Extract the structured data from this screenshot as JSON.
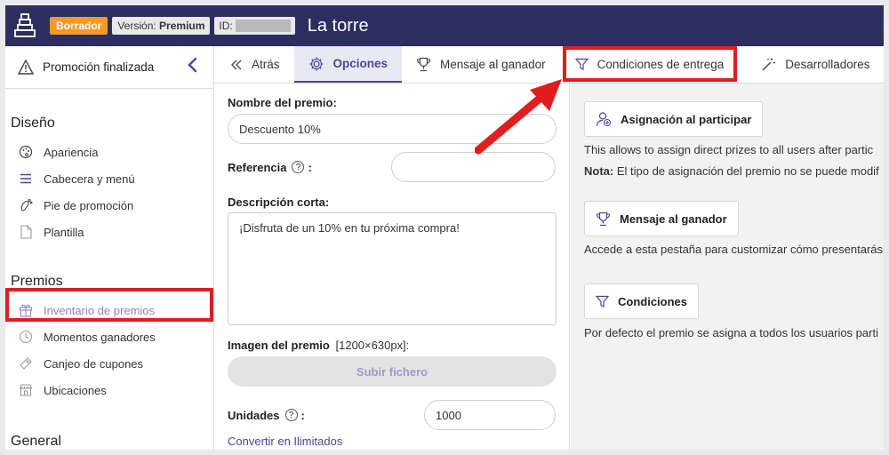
{
  "header": {
    "status_badge": "Borrador",
    "version_prefix": "Versión: ",
    "version_value": "Premium",
    "id_label": "ID:",
    "title": "La torre"
  },
  "sidebar": {
    "promo_status": "Promoción finalizada",
    "sections": [
      {
        "title": "Diseño",
        "items": [
          {
            "label": "Apariencia",
            "icon": "palette-icon"
          },
          {
            "label": "Cabecera y menú",
            "icon": "menu-icon"
          },
          {
            "label": "Pie de promoción",
            "icon": "footprint-icon"
          },
          {
            "label": "Plantilla",
            "icon": "document-icon"
          }
        ]
      },
      {
        "title": "Premios",
        "items": [
          {
            "label": "Inventario de premios",
            "icon": "gift-icon",
            "active": true
          },
          {
            "label": "Momentos ganadores",
            "icon": "clock-icon"
          },
          {
            "label": "Canjeo de cupones",
            "icon": "coupon-icon"
          },
          {
            "label": "Ubicaciones",
            "icon": "store-icon"
          }
        ]
      },
      {
        "title": "General",
        "items": []
      }
    ]
  },
  "tabs": [
    {
      "label": "Atrás",
      "icon": "double-chevron-left-icon"
    },
    {
      "label": "Opciones",
      "icon": "gear-icon",
      "active": true
    },
    {
      "label": "Mensaje al ganador",
      "icon": "trophy-icon"
    },
    {
      "label": "Condiciones de entrega",
      "icon": "filter-icon"
    },
    {
      "label": "Desarrolladores",
      "icon": "wand-icon"
    }
  ],
  "form": {
    "prize_name_label": "Nombre del premio:",
    "prize_name_value": "Descuento 10%",
    "reference_label": "Referencia",
    "reference_value": "",
    "short_desc_label": "Descripción corta:",
    "short_desc_value": "¡Disfruta de un 10% en tu próxima compra!",
    "image_label": "Imagen del premio",
    "image_size": "[1200×630px]:",
    "upload_label": "Subir fichero",
    "units_label": "Unidades",
    "units_value": "1000",
    "unlimited_link": "Convertir en Ilimitados",
    "help_glyph": "?",
    "colon": ":"
  },
  "right_panel": {
    "assign_button": "Asignación al participar",
    "assign_text": "This allows to assign direct prizes to all users after partic",
    "note_label": "Nota:",
    "note_text": " El tipo de asignación del premio no se puede modif",
    "winner_button": "Mensaje al ganador",
    "winner_text": "Accede a esta pestaña para customizar cómo presentarás",
    "conditions_button": "Condiciones",
    "conditions_text": "Por defecto el premio se asigna a todos los usuarios parti"
  },
  "colors": {
    "topbar": "#2b2e5e",
    "accent": "#4a469a",
    "draft_badge": "#f59a23",
    "highlight": "#e01e1e"
  }
}
